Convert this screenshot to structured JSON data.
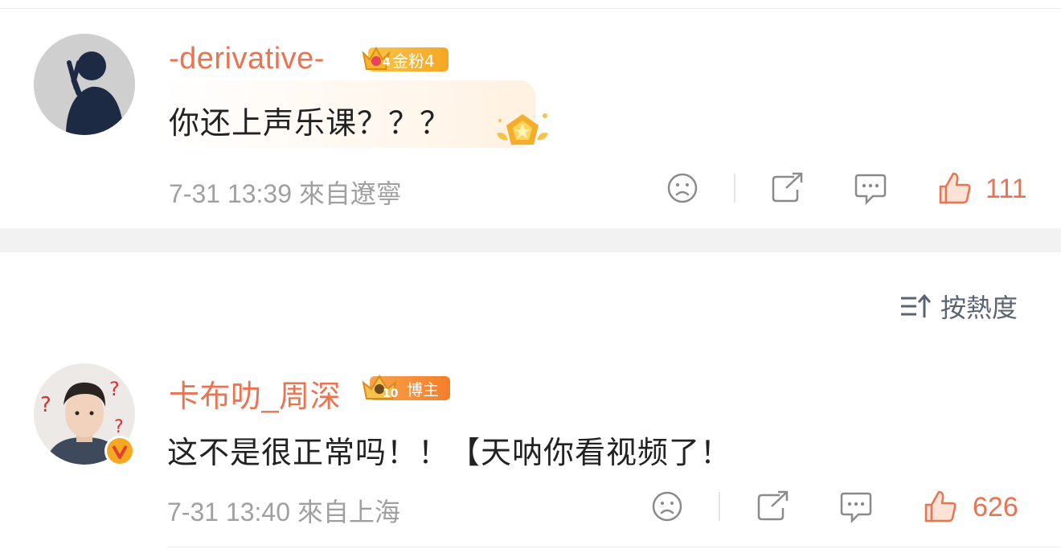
{
  "comments": [
    {
      "username": "-derivative-",
      "badge_text": "金粉4",
      "badge_level": "4",
      "text": "你还上声乐课？？？",
      "meta": "7-31 13:39  來自遼寧",
      "likes": "111"
    },
    {
      "username": "卡布叻_周深",
      "badge_text": "博主",
      "badge_level": "10",
      "text": "这不是很正常吗！！【天呐你看视频了！",
      "meta": "7-31 13:40  來自上海",
      "likes": "626"
    }
  ],
  "sort": {
    "label": "按熱度"
  },
  "colors": {
    "accent": "#eb7350",
    "badge_gold": "#f5b731",
    "badge_orange": "#f7892e",
    "verified": "#f7a823"
  },
  "icons": [
    "sad-face-icon",
    "share-icon",
    "comment-icon",
    "thumbs-up-icon",
    "sort-icon",
    "crown-badge-icon",
    "verified-v-icon"
  ]
}
